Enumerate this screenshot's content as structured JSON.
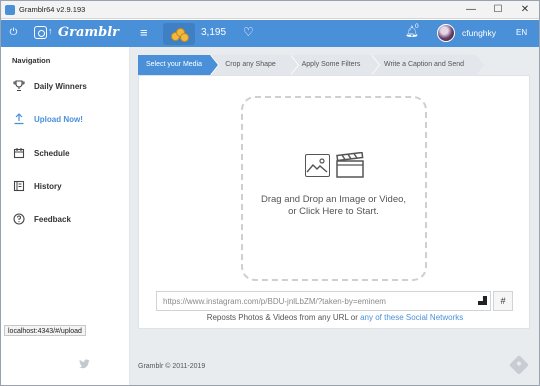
{
  "window": {
    "title": "Gramblr64 v2.9.193",
    "min": "—",
    "max": "☐",
    "close": "✕"
  },
  "topbar": {
    "brand": "Gramblr",
    "credits": "3,195",
    "notifications": "0",
    "username": "cfunghky",
    "language": "EN"
  },
  "sidebar": {
    "heading": "Navigation",
    "items": [
      {
        "label": "Daily Winners",
        "icon": "trophy-icon"
      },
      {
        "label": "Upload Now!",
        "icon": "upload-icon",
        "active": true
      },
      {
        "label": "Schedule",
        "icon": "calendar-icon"
      },
      {
        "label": "History",
        "icon": "history-icon"
      },
      {
        "label": "Feedback",
        "icon": "question-icon"
      }
    ]
  },
  "steps": [
    {
      "label": "Select your Media",
      "active": true
    },
    {
      "label": "Crop any Shape"
    },
    {
      "label": "Apply Some Filters"
    },
    {
      "label": "Write a Caption and Send"
    }
  ],
  "dropzone": {
    "line1": "Drag and Drop an Image or Video,",
    "line2": "or Click Here to Start."
  },
  "url_input": {
    "placeholder": "https://www.instagram.com/p/BDU-jnlLbZM/?taken-by=eminem"
  },
  "hash_button": "#",
  "reposts": {
    "text": "Reposts Photos & Videos from any URL or ",
    "link": "any of these Social Networks"
  },
  "footer": {
    "copyright": "Gramblr © 2011-2019"
  },
  "status_url": "localhost:4343/#/upload",
  "colors": {
    "accent": "#4a90d9",
    "main_bg": "#e9ecef"
  }
}
